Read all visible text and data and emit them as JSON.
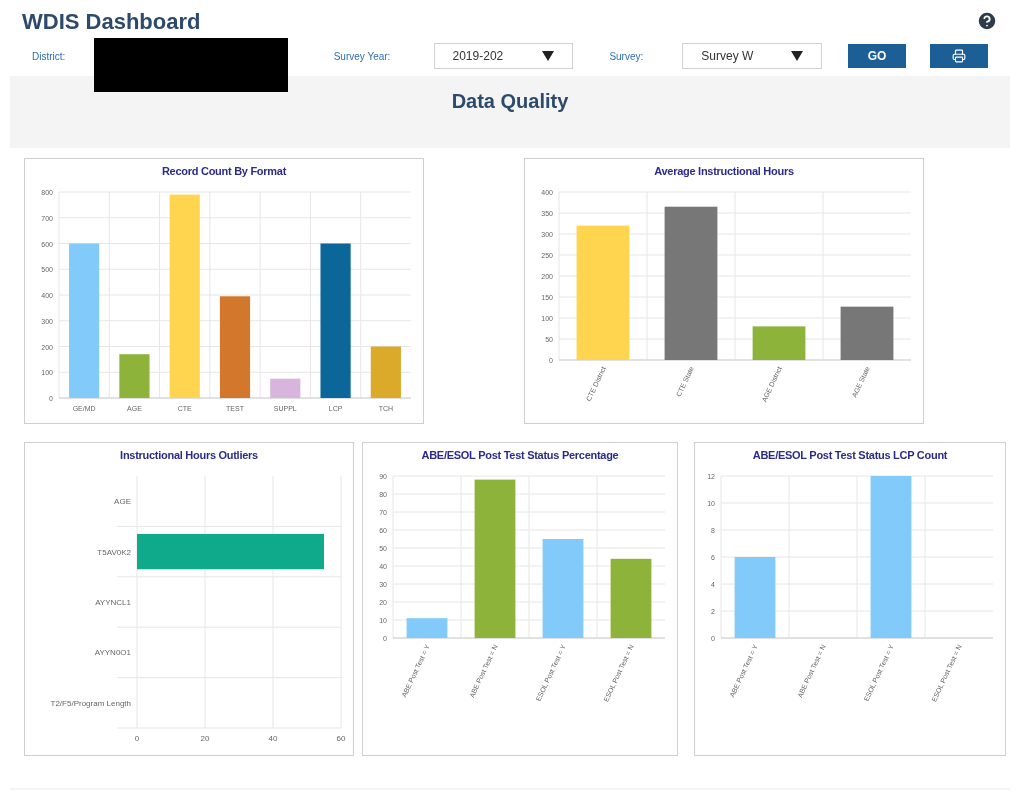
{
  "header": {
    "title": "WDIS Dashboard"
  },
  "filters": {
    "district_label": "District:",
    "year_label": "Survey Year:",
    "year_value": "2019-202",
    "survey_label": "Survey:",
    "survey_value": "Survey W",
    "go_button": "GO"
  },
  "section": {
    "title": "Data Quality"
  },
  "charts": [
    {
      "title": "Record Count By Format",
      "chart_data": {
        "type": "bar",
        "grid": true,
        "categories": [
          "GE/MD",
          "AGE",
          "CTE",
          "TEST",
          "SUPPL",
          "LCP",
          "TCH"
        ],
        "series": [
          {
            "colors": [
              "#81cafa",
              "#8db33a",
              "#ffd54f",
              "#d2772c",
              "#d8b5dc",
              "#0b6699",
              "#dcaa2a"
            ],
            "values": [
              600,
              170,
              790,
              395,
              75,
              600,
              200
            ]
          }
        ],
        "ylim": [
          0,
          800
        ],
        "yticks": [
          0,
          100,
          200,
          300,
          400,
          500,
          600,
          700,
          800
        ]
      }
    },
    {
      "title": "Average Instructional Hours",
      "chart_data": {
        "type": "bar",
        "grid": true,
        "categories": [
          "CTE District",
          "CTE State",
          "AGE District",
          "AGE State"
        ],
        "series": [
          {
            "colors": [
              "#ffd54f",
              "#777777",
              "#8db33a",
              "#777777"
            ],
            "values": [
              320,
              365,
              80,
              127
            ]
          }
        ],
        "ylim": [
          0,
          400
        ],
        "yticks": [
          0,
          50,
          100,
          150,
          200,
          250,
          300,
          350,
          400
        ]
      }
    },
    {
      "title": "Instructional Hours Outliers",
      "chart_data": {
        "type": "bar",
        "grid": true,
        "orientation": "horizontal",
        "categories": [
          "AGE",
          "T5AV0K2",
          "AYYNCL1",
          "AYYN0O1",
          "T2/F5/Program Length"
        ],
        "series": [
          {
            "color": "#0fa98b",
            "values": [
              null,
              55,
              null,
              null,
              null
            ]
          }
        ],
        "xlim": [
          0,
          60
        ],
        "xticks": [
          0,
          20,
          40,
          60
        ]
      }
    },
    {
      "title": "ABE/ESOL Post Test Status Percentage",
      "chart_data": {
        "type": "bar",
        "grid": true,
        "categories": [
          "ABE Post Test = Y",
          "ABE Post Test = N",
          "ESOL Post Test = Y",
          "ESOL Post Test = N"
        ],
        "series": [
          {
            "colors": [
              "#81cafa",
              "#8db33a",
              "#81cafa",
              "#8db33a"
            ],
            "values": [
              11,
              88,
              55,
              44
            ]
          }
        ],
        "ylim": [
          0,
          90
        ],
        "yticks": [
          0,
          10,
          20,
          30,
          40,
          50,
          60,
          70,
          80,
          90
        ]
      }
    },
    {
      "title": "ABE/ESOL Post Test Status LCP Count",
      "chart_data": {
        "type": "bar",
        "grid": true,
        "categories": [
          "ABE Post Test = Y",
          "ABE Post Test = N",
          "ESOL Post Test = Y",
          "ESOL Post Test = N"
        ],
        "series": [
          {
            "color": "#81cafa",
            "values": [
              6,
              null,
              12,
              null
            ]
          }
        ],
        "ylim": [
          0,
          12
        ],
        "yticks": [
          0,
          2,
          4,
          6,
          8,
          10,
          12
        ]
      }
    }
  ]
}
